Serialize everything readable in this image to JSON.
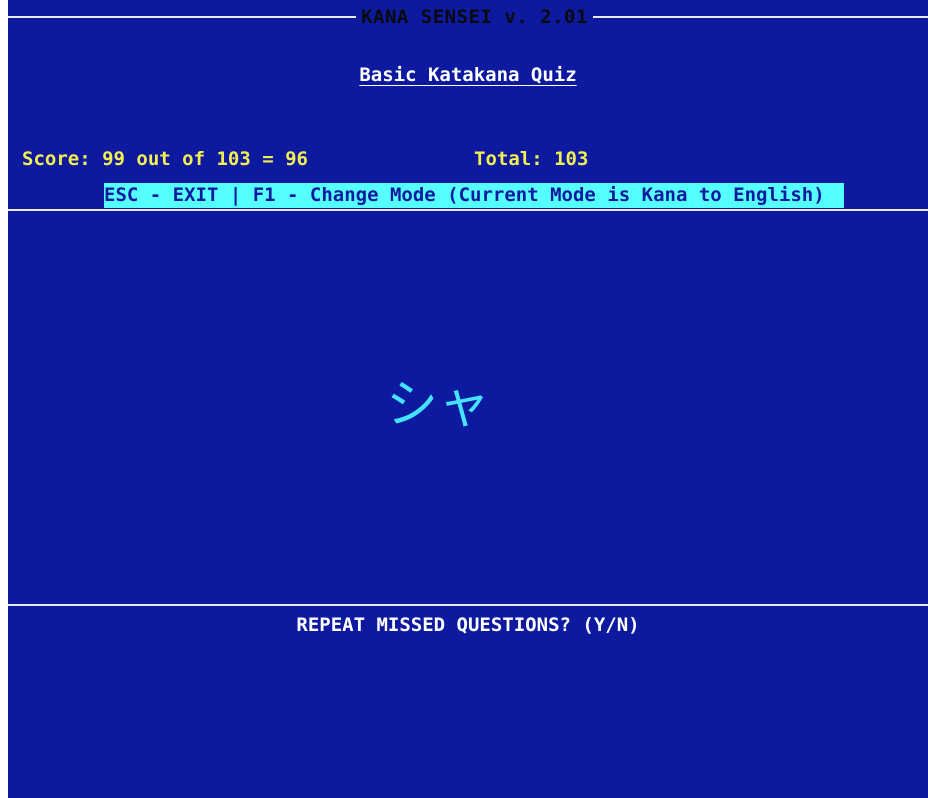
{
  "app": {
    "title": "KANA SENSEI v. 2.01",
    "subtitle": "Basic Katakana Quiz"
  },
  "stats": {
    "score_text": "Score: 99 out of 103 = 96",
    "total_text": "Total: 103"
  },
  "help_bar": {
    "text": "ESC - EXIT | F1 - Change Mode (Current Mode is Kana to English)"
  },
  "quiz": {
    "kana": "シャ"
  },
  "prompt": {
    "text": "REPEAT MISSED QUESTIONS? (Y/N)"
  },
  "colors": {
    "background": "#0d1aa0",
    "score_yellow": "#f2ef52",
    "help_bar_cyan": "#55ffff",
    "kana_cyan": "#45e3ff",
    "text_white": "#ffffff"
  }
}
